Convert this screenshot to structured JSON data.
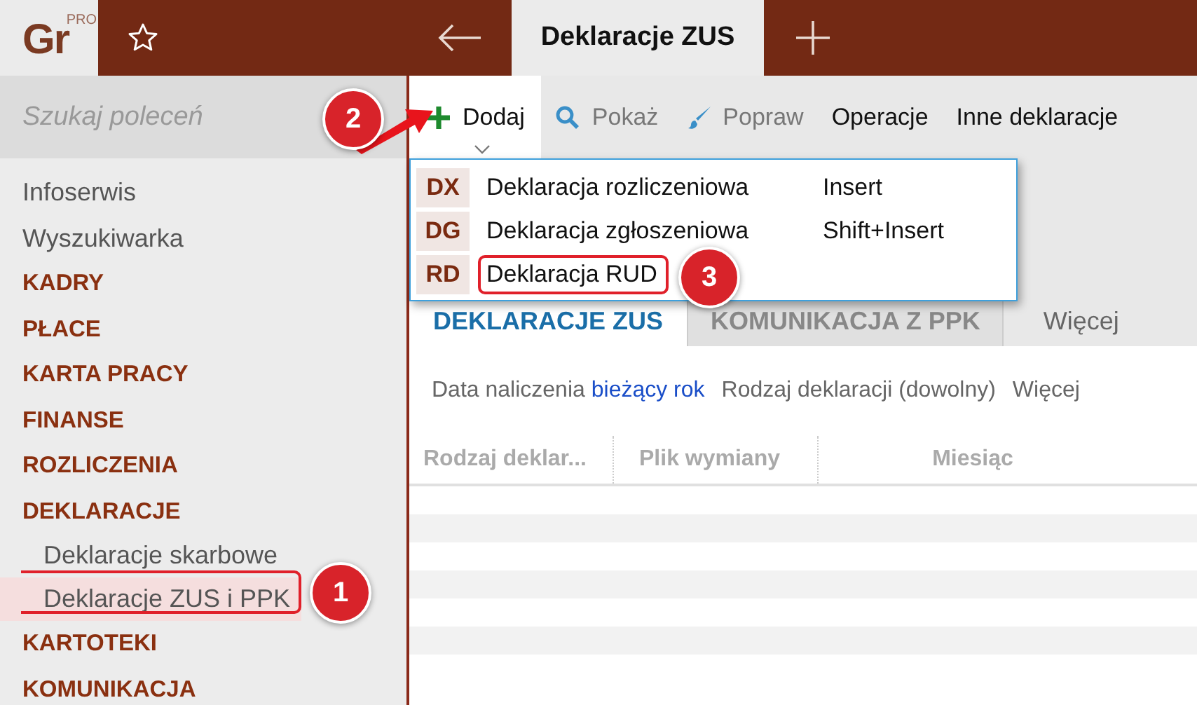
{
  "logo": {
    "text": "Gr",
    "badge": "PRO"
  },
  "top_tabs": [
    {
      "label": "Deklaracje ZUS",
      "selected": true
    }
  ],
  "search": {
    "placeholder": "Szukaj poleceń"
  },
  "sidebar": {
    "items": [
      {
        "label": "Infoserwis",
        "kind": "link"
      },
      {
        "label": "Wyszukiwarka",
        "kind": "link"
      },
      {
        "label": "KADRY",
        "kind": "section"
      },
      {
        "label": "PŁACE",
        "kind": "section"
      },
      {
        "label": "KARTA PRACY",
        "kind": "section"
      },
      {
        "label": "FINANSE",
        "kind": "section"
      },
      {
        "label": "ROZLICZENIA",
        "kind": "section"
      },
      {
        "label": "DEKLARACJE",
        "kind": "section",
        "children": [
          {
            "label": "Deklaracje skarbowe",
            "selected": false
          },
          {
            "label": "Deklaracje ZUS i PPK",
            "selected": true
          }
        ]
      },
      {
        "label": "KARTOTEKI",
        "kind": "section"
      },
      {
        "label": "KOMUNIKACJA",
        "kind": "section"
      }
    ]
  },
  "toolbar": [
    {
      "label": "Dodaj",
      "kind": "plus",
      "selected": true
    },
    {
      "label": "Pokaż",
      "kind": "search",
      "selected": false
    },
    {
      "label": "Popraw",
      "kind": "brush",
      "selected": false
    },
    {
      "label": "Operacje",
      "kind": "plain",
      "selected": false
    },
    {
      "label": "Inne deklaracje",
      "kind": "plain",
      "selected": false
    }
  ],
  "dropdown": [
    {
      "code": "DX",
      "label": "Deklaracja rozliczeniowa",
      "shortcut": "Insert"
    },
    {
      "code": "DG",
      "label": "Deklaracja zgłoszeniowa",
      "shortcut": "Shift+Insert"
    },
    {
      "code": "RD",
      "label": "Deklaracja RUD"
    }
  ],
  "tabs": [
    {
      "label": "DEKLARACJE ZUS",
      "selected": true
    },
    {
      "label": "KOMUNIKACJA Z PPK",
      "selected": false
    }
  ],
  "tabs_more": "Więcej",
  "filters": [
    {
      "label": "Data naliczenia",
      "value": "bieżący rok"
    },
    {
      "label": "Rodzaj deklaracji (dowolny)"
    },
    {
      "label": "Więcej"
    }
  ],
  "table": {
    "columns": [
      "Rodzaj deklar...",
      "Plik wymiany",
      "Miesiąc"
    ]
  },
  "annotations": [
    {
      "label": "1"
    },
    {
      "label": "2"
    },
    {
      "label": "3"
    }
  ]
}
